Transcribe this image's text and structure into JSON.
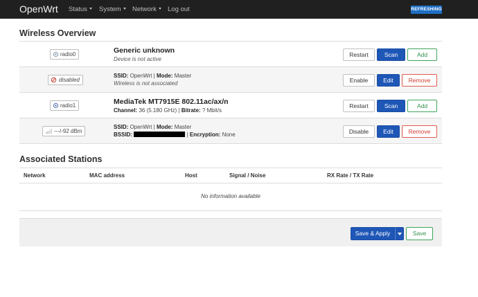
{
  "header": {
    "brand": "OpenWrt",
    "menu": [
      "Status",
      "System",
      "Network",
      "Log out"
    ],
    "refresh_badge": "REFRESHING"
  },
  "wireless_overview": {
    "heading": "Wireless Overview",
    "rows": [
      {
        "badge": "radio0",
        "title": "Generic unknown",
        "subtitle": "Device is not active",
        "buttons": [
          "Restart",
          "Scan",
          "Add"
        ]
      },
      {
        "badge": "disabled",
        "ssid_label": "SSID:",
        "ssid": "OpenWrt",
        "mode_label": "Mode:",
        "mode": "Master",
        "subtitle": "Wireless is not associated",
        "buttons": [
          "Enable",
          "Edit",
          "Remove"
        ]
      },
      {
        "badge": "radio1",
        "title": "MediaTek MT7915E 802.11ac/ax/n",
        "channel_label": "Channel:",
        "channel": "36 (5.180 GHz)",
        "bitrate_label": "Bitrate:",
        "bitrate": "? Mbit/s",
        "buttons": [
          "Restart",
          "Scan",
          "Add"
        ]
      },
      {
        "badge": "---/-92 dBm",
        "ssid_label": "SSID:",
        "ssid": "OpenWrt",
        "mode_label": "Mode:",
        "mode": "Master",
        "bssid_label": "BSSID:",
        "encryption_label": "Encryption:",
        "encryption": "None",
        "buttons": [
          "Disable",
          "Edit",
          "Remove"
        ]
      }
    ]
  },
  "associated_stations": {
    "heading": "Associated Stations",
    "columns": [
      "Network",
      "MAC address",
      "Host",
      "Signal / Noise",
      "RX Rate / TX Rate"
    ],
    "empty_text": "No information available"
  },
  "footer": {
    "save_apply": "Save & Apply",
    "save": "Save"
  },
  "colors": {
    "topbar": "#202020",
    "primary_blue": "#1f57b7",
    "badge_blue": "#1f6fc5",
    "success_green": "#3fa45b",
    "danger_red": "#e05a4e"
  }
}
